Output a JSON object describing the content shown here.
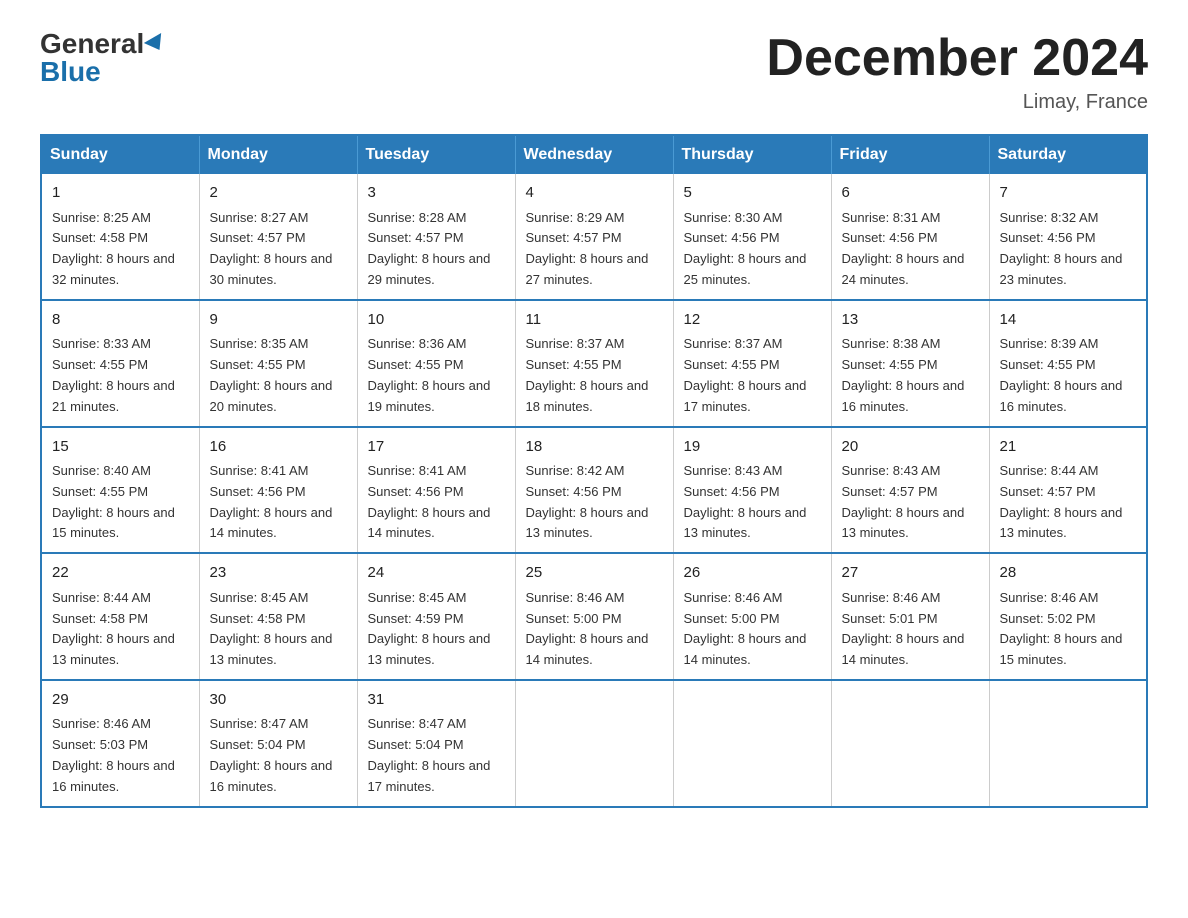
{
  "logo": {
    "general": "General",
    "blue": "Blue"
  },
  "title": "December 2024",
  "location": "Limay, France",
  "headers": [
    "Sunday",
    "Monday",
    "Tuesday",
    "Wednesday",
    "Thursday",
    "Friday",
    "Saturday"
  ],
  "weeks": [
    [
      {
        "day": "1",
        "sunrise": "8:25 AM",
        "sunset": "4:58 PM",
        "daylight": "8 hours and 32 minutes."
      },
      {
        "day": "2",
        "sunrise": "8:27 AM",
        "sunset": "4:57 PM",
        "daylight": "8 hours and 30 minutes."
      },
      {
        "day": "3",
        "sunrise": "8:28 AM",
        "sunset": "4:57 PM",
        "daylight": "8 hours and 29 minutes."
      },
      {
        "day": "4",
        "sunrise": "8:29 AM",
        "sunset": "4:57 PM",
        "daylight": "8 hours and 27 minutes."
      },
      {
        "day": "5",
        "sunrise": "8:30 AM",
        "sunset": "4:56 PM",
        "daylight": "8 hours and 25 minutes."
      },
      {
        "day": "6",
        "sunrise": "8:31 AM",
        "sunset": "4:56 PM",
        "daylight": "8 hours and 24 minutes."
      },
      {
        "day": "7",
        "sunrise": "8:32 AM",
        "sunset": "4:56 PM",
        "daylight": "8 hours and 23 minutes."
      }
    ],
    [
      {
        "day": "8",
        "sunrise": "8:33 AM",
        "sunset": "4:55 PM",
        "daylight": "8 hours and 21 minutes."
      },
      {
        "day": "9",
        "sunrise": "8:35 AM",
        "sunset": "4:55 PM",
        "daylight": "8 hours and 20 minutes."
      },
      {
        "day": "10",
        "sunrise": "8:36 AM",
        "sunset": "4:55 PM",
        "daylight": "8 hours and 19 minutes."
      },
      {
        "day": "11",
        "sunrise": "8:37 AM",
        "sunset": "4:55 PM",
        "daylight": "8 hours and 18 minutes."
      },
      {
        "day": "12",
        "sunrise": "8:37 AM",
        "sunset": "4:55 PM",
        "daylight": "8 hours and 17 minutes."
      },
      {
        "day": "13",
        "sunrise": "8:38 AM",
        "sunset": "4:55 PM",
        "daylight": "8 hours and 16 minutes."
      },
      {
        "day": "14",
        "sunrise": "8:39 AM",
        "sunset": "4:55 PM",
        "daylight": "8 hours and 16 minutes."
      }
    ],
    [
      {
        "day": "15",
        "sunrise": "8:40 AM",
        "sunset": "4:55 PM",
        "daylight": "8 hours and 15 minutes."
      },
      {
        "day": "16",
        "sunrise": "8:41 AM",
        "sunset": "4:56 PM",
        "daylight": "8 hours and 14 minutes."
      },
      {
        "day": "17",
        "sunrise": "8:41 AM",
        "sunset": "4:56 PM",
        "daylight": "8 hours and 14 minutes."
      },
      {
        "day": "18",
        "sunrise": "8:42 AM",
        "sunset": "4:56 PM",
        "daylight": "8 hours and 13 minutes."
      },
      {
        "day": "19",
        "sunrise": "8:43 AM",
        "sunset": "4:56 PM",
        "daylight": "8 hours and 13 minutes."
      },
      {
        "day": "20",
        "sunrise": "8:43 AM",
        "sunset": "4:57 PM",
        "daylight": "8 hours and 13 minutes."
      },
      {
        "day": "21",
        "sunrise": "8:44 AM",
        "sunset": "4:57 PM",
        "daylight": "8 hours and 13 minutes."
      }
    ],
    [
      {
        "day": "22",
        "sunrise": "8:44 AM",
        "sunset": "4:58 PM",
        "daylight": "8 hours and 13 minutes."
      },
      {
        "day": "23",
        "sunrise": "8:45 AM",
        "sunset": "4:58 PM",
        "daylight": "8 hours and 13 minutes."
      },
      {
        "day": "24",
        "sunrise": "8:45 AM",
        "sunset": "4:59 PM",
        "daylight": "8 hours and 13 minutes."
      },
      {
        "day": "25",
        "sunrise": "8:46 AM",
        "sunset": "5:00 PM",
        "daylight": "8 hours and 14 minutes."
      },
      {
        "day": "26",
        "sunrise": "8:46 AM",
        "sunset": "5:00 PM",
        "daylight": "8 hours and 14 minutes."
      },
      {
        "day": "27",
        "sunrise": "8:46 AM",
        "sunset": "5:01 PM",
        "daylight": "8 hours and 14 minutes."
      },
      {
        "day": "28",
        "sunrise": "8:46 AM",
        "sunset": "5:02 PM",
        "daylight": "8 hours and 15 minutes."
      }
    ],
    [
      {
        "day": "29",
        "sunrise": "8:46 AM",
        "sunset": "5:03 PM",
        "daylight": "8 hours and 16 minutes."
      },
      {
        "day": "30",
        "sunrise": "8:47 AM",
        "sunset": "5:04 PM",
        "daylight": "8 hours and 16 minutes."
      },
      {
        "day": "31",
        "sunrise": "8:47 AM",
        "sunset": "5:04 PM",
        "daylight": "8 hours and 17 minutes."
      },
      null,
      null,
      null,
      null
    ]
  ]
}
